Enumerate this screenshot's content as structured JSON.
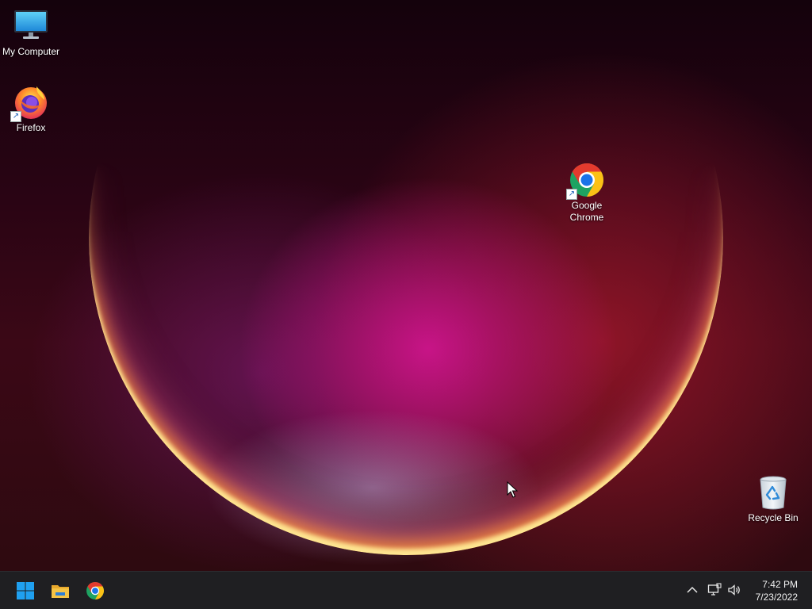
{
  "desktop": {
    "icons": [
      {
        "label": "My Computer",
        "icon": "monitor-icon"
      },
      {
        "label": "Firefox",
        "icon": "firefox-icon",
        "shortcut": true
      },
      {
        "label": "Google\nChrome",
        "icon": "chrome-icon",
        "shortcut": true
      },
      {
        "label": "Recycle Bin",
        "icon": "recycle-bin-icon"
      }
    ]
  },
  "taskbar": {
    "pinned": [
      {
        "name": "Start",
        "icon": "windows-start-icon"
      },
      {
        "name": "File Explorer",
        "icon": "folder-icon"
      },
      {
        "name": "Google Chrome",
        "icon": "chrome-icon"
      }
    ],
    "tray": {
      "overflow_icon": "chevron-up-icon",
      "network_icon": "network-icon",
      "volume_icon": "volume-icon"
    },
    "clock": {
      "time": "7:42 PM",
      "date": "7/23/2022"
    }
  },
  "colors": {
    "taskbar_bg": "#1f1f22",
    "start_blue": "#1fa0f0",
    "folder_yellow": "#f6c445"
  }
}
